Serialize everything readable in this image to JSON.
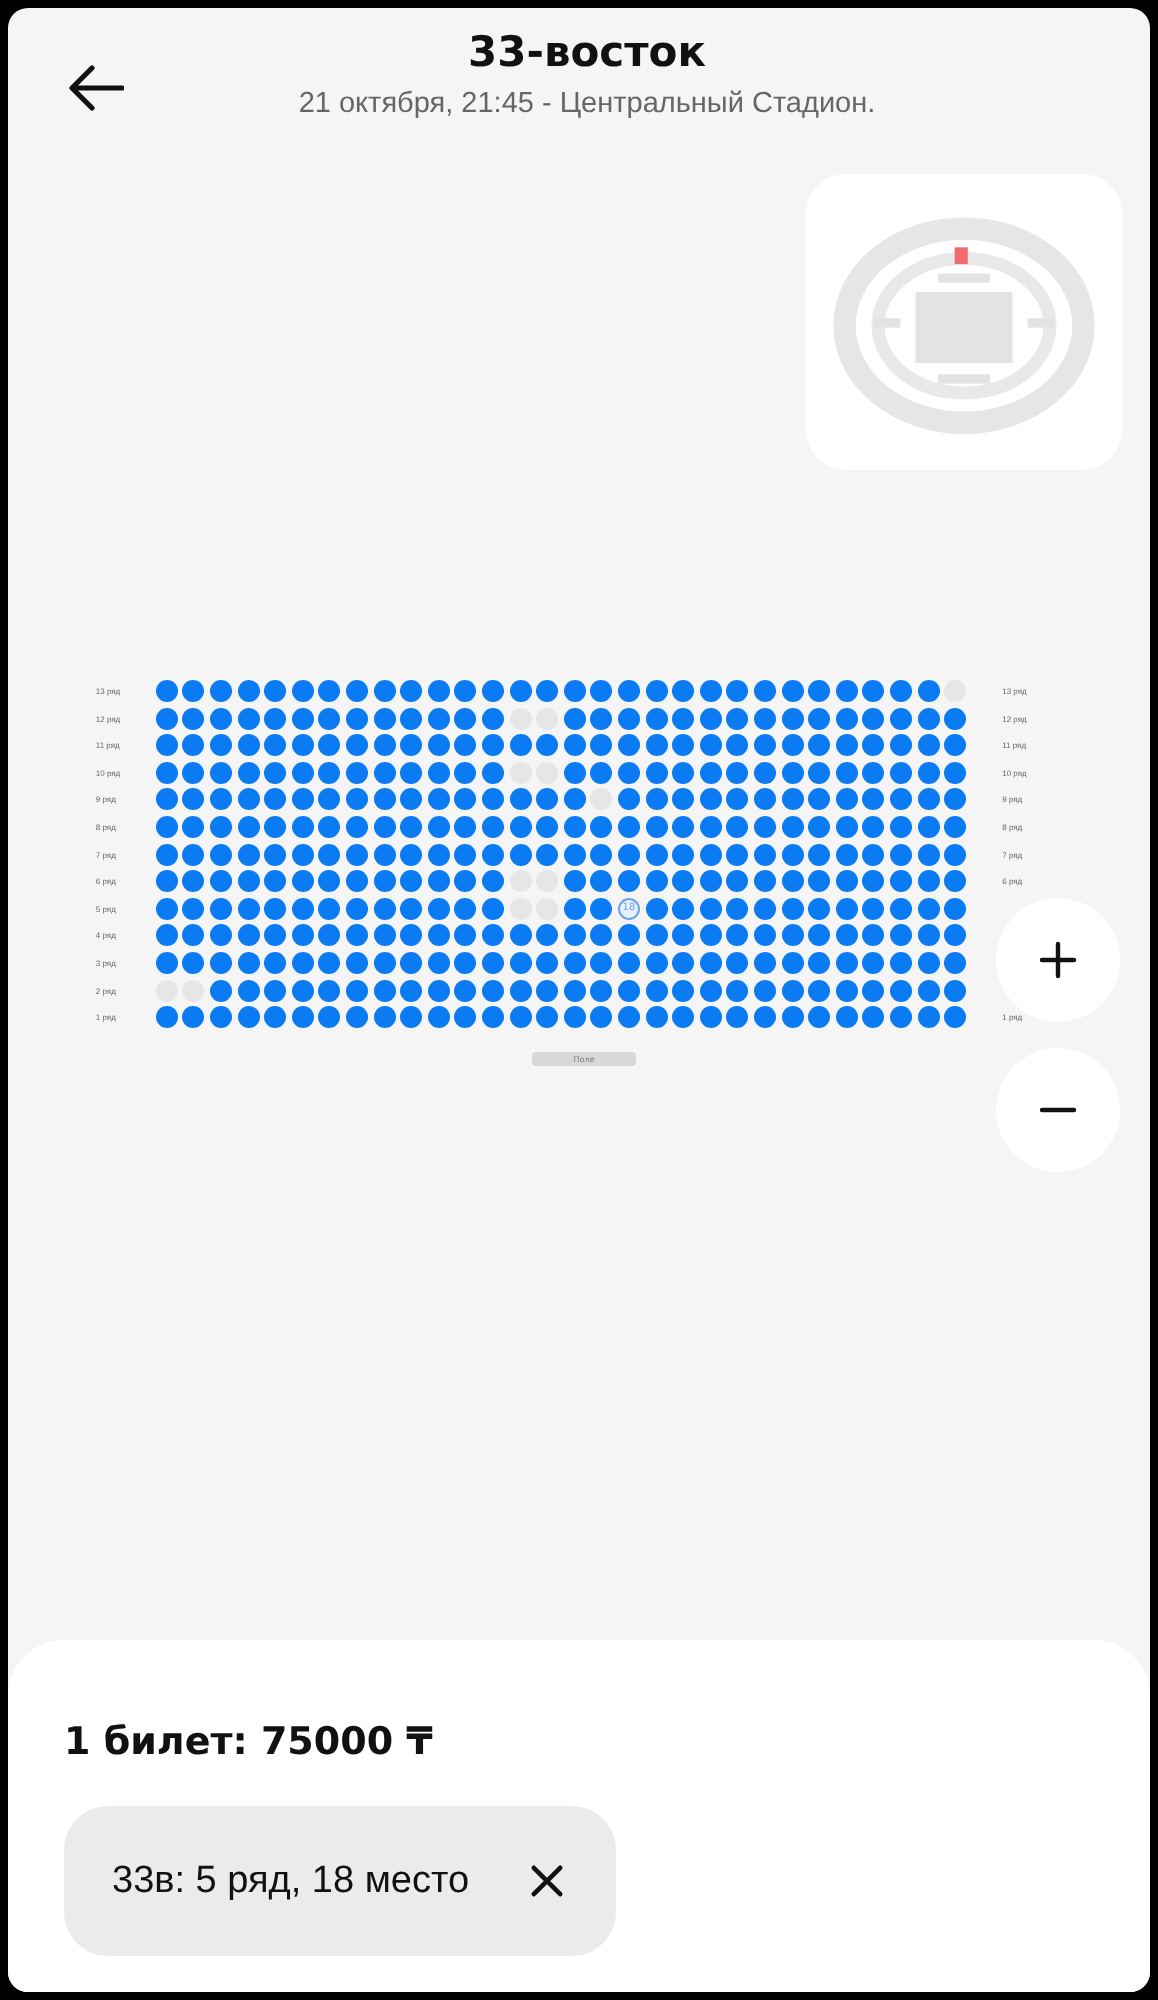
{
  "header": {
    "title": "33-восток",
    "subtitle": "21 октября, 21:45 - Центральный Стадион."
  },
  "seat_map": {
    "rows": [
      {
        "label_left": "13 ряд",
        "label_right": "13 ряд",
        "seats": [
          {
            "taken": false,
            "selected": false
          },
          {
            "taken": false,
            "selected": false
          },
          {
            "taken": false,
            "selected": false
          },
          {
            "taken": false,
            "selected": false
          },
          {
            "taken": false,
            "selected": false
          },
          {
            "taken": false,
            "selected": false
          },
          {
            "taken": false,
            "selected": false
          },
          {
            "taken": false,
            "selected": false
          },
          {
            "taken": false,
            "selected": false
          },
          {
            "taken": false,
            "selected": false
          },
          {
            "taken": false,
            "selected": false
          },
          {
            "taken": false,
            "selected": false
          },
          {
            "taken": false,
            "selected": false
          },
          {
            "taken": false,
            "selected": false
          },
          {
            "taken": false,
            "selected": false
          },
          {
            "taken": false,
            "selected": false
          },
          {
            "taken": false,
            "selected": false
          },
          {
            "taken": false,
            "selected": false
          },
          {
            "taken": false,
            "selected": false
          },
          {
            "taken": false,
            "selected": false
          },
          {
            "taken": false,
            "selected": false
          },
          {
            "taken": false,
            "selected": false
          },
          {
            "taken": false,
            "selected": false
          },
          {
            "taken": false,
            "selected": false
          },
          {
            "taken": false,
            "selected": false
          },
          {
            "taken": false,
            "selected": false
          },
          {
            "taken": false,
            "selected": false
          },
          {
            "taken": false,
            "selected": false
          },
          {
            "taken": false,
            "selected": false
          },
          {
            "taken": true,
            "selected": false
          }
        ]
      },
      {
        "label_left": "12 ряд",
        "label_right": "12 ряд",
        "seats": [
          {
            "taken": false,
            "selected": false
          },
          {
            "taken": false,
            "selected": false
          },
          {
            "taken": false,
            "selected": false
          },
          {
            "taken": false,
            "selected": false
          },
          {
            "taken": false,
            "selected": false
          },
          {
            "taken": false,
            "selected": false
          },
          {
            "taken": false,
            "selected": false
          },
          {
            "taken": false,
            "selected": false
          },
          {
            "taken": false,
            "selected": false
          },
          {
            "taken": false,
            "selected": false
          },
          {
            "taken": false,
            "selected": false
          },
          {
            "taken": false,
            "selected": false
          },
          {
            "taken": false,
            "selected": false
          },
          {
            "taken": true,
            "selected": false
          },
          {
            "taken": true,
            "selected": false
          },
          {
            "taken": false,
            "selected": false
          },
          {
            "taken": false,
            "selected": false
          },
          {
            "taken": false,
            "selected": false
          },
          {
            "taken": false,
            "selected": false
          },
          {
            "taken": false,
            "selected": false
          },
          {
            "taken": false,
            "selected": false
          },
          {
            "taken": false,
            "selected": false
          },
          {
            "taken": false,
            "selected": false
          },
          {
            "taken": false,
            "selected": false
          },
          {
            "taken": false,
            "selected": false
          },
          {
            "taken": false,
            "selected": false
          },
          {
            "taken": false,
            "selected": false
          },
          {
            "taken": false,
            "selected": false
          },
          {
            "taken": false,
            "selected": false
          },
          {
            "taken": false,
            "selected": false
          }
        ]
      },
      {
        "label_left": "11 ряд",
        "label_right": "11 ряд",
        "seats": [
          {
            "taken": false,
            "selected": false
          },
          {
            "taken": false,
            "selected": false
          },
          {
            "taken": false,
            "selected": false
          },
          {
            "taken": false,
            "selected": false
          },
          {
            "taken": false,
            "selected": false
          },
          {
            "taken": false,
            "selected": false
          },
          {
            "taken": false,
            "selected": false
          },
          {
            "taken": false,
            "selected": false
          },
          {
            "taken": false,
            "selected": false
          },
          {
            "taken": false,
            "selected": false
          },
          {
            "taken": false,
            "selected": false
          },
          {
            "taken": false,
            "selected": false
          },
          {
            "taken": false,
            "selected": false
          },
          {
            "taken": false,
            "selected": false
          },
          {
            "taken": false,
            "selected": false
          },
          {
            "taken": false,
            "selected": false
          },
          {
            "taken": false,
            "selected": false
          },
          {
            "taken": false,
            "selected": false
          },
          {
            "taken": false,
            "selected": false
          },
          {
            "taken": false,
            "selected": false
          },
          {
            "taken": false,
            "selected": false
          },
          {
            "taken": false,
            "selected": false
          },
          {
            "taken": false,
            "selected": false
          },
          {
            "taken": false,
            "selected": false
          },
          {
            "taken": false,
            "selected": false
          },
          {
            "taken": false,
            "selected": false
          },
          {
            "taken": false,
            "selected": false
          },
          {
            "taken": false,
            "selected": false
          },
          {
            "taken": false,
            "selected": false
          },
          {
            "taken": false,
            "selected": false
          }
        ]
      },
      {
        "label_left": "10 ряд",
        "label_right": "10 ряд",
        "seats": [
          {
            "taken": false,
            "selected": false
          },
          {
            "taken": false,
            "selected": false
          },
          {
            "taken": false,
            "selected": false
          },
          {
            "taken": false,
            "selected": false
          },
          {
            "taken": false,
            "selected": false
          },
          {
            "taken": false,
            "selected": false
          },
          {
            "taken": false,
            "selected": false
          },
          {
            "taken": false,
            "selected": false
          },
          {
            "taken": false,
            "selected": false
          },
          {
            "taken": false,
            "selected": false
          },
          {
            "taken": false,
            "selected": false
          },
          {
            "taken": false,
            "selected": false
          },
          {
            "taken": false,
            "selected": false
          },
          {
            "taken": true,
            "selected": false
          },
          {
            "taken": true,
            "selected": false
          },
          {
            "taken": false,
            "selected": false
          },
          {
            "taken": false,
            "selected": false
          },
          {
            "taken": false,
            "selected": false
          },
          {
            "taken": false,
            "selected": false
          },
          {
            "taken": false,
            "selected": false
          },
          {
            "taken": false,
            "selected": false
          },
          {
            "taken": false,
            "selected": false
          },
          {
            "taken": false,
            "selected": false
          },
          {
            "taken": false,
            "selected": false
          },
          {
            "taken": false,
            "selected": false
          },
          {
            "taken": false,
            "selected": false
          },
          {
            "taken": false,
            "selected": false
          },
          {
            "taken": false,
            "selected": false
          },
          {
            "taken": false,
            "selected": false
          },
          {
            "taken": false,
            "selected": false
          }
        ]
      },
      {
        "label_left": "9 ряд",
        "label_right": "9 ряд",
        "seats": [
          {
            "taken": false,
            "selected": false
          },
          {
            "taken": false,
            "selected": false
          },
          {
            "taken": false,
            "selected": false
          },
          {
            "taken": false,
            "selected": false
          },
          {
            "taken": false,
            "selected": false
          },
          {
            "taken": false,
            "selected": false
          },
          {
            "taken": false,
            "selected": false
          },
          {
            "taken": false,
            "selected": false
          },
          {
            "taken": false,
            "selected": false
          },
          {
            "taken": false,
            "selected": false
          },
          {
            "taken": false,
            "selected": false
          },
          {
            "taken": false,
            "selected": false
          },
          {
            "taken": false,
            "selected": false
          },
          {
            "taken": false,
            "selected": false
          },
          {
            "taken": false,
            "selected": false
          },
          {
            "taken": false,
            "selected": false
          },
          {
            "taken": true,
            "selected": false
          },
          {
            "taken": false,
            "selected": false
          },
          {
            "taken": false,
            "selected": false
          },
          {
            "taken": false,
            "selected": false
          },
          {
            "taken": false,
            "selected": false
          },
          {
            "taken": false,
            "selected": false
          },
          {
            "taken": false,
            "selected": false
          },
          {
            "taken": false,
            "selected": false
          },
          {
            "taken": false,
            "selected": false
          },
          {
            "taken": false,
            "selected": false
          },
          {
            "taken": false,
            "selected": false
          },
          {
            "taken": false,
            "selected": false
          },
          {
            "taken": false,
            "selected": false
          },
          {
            "taken": false,
            "selected": false
          }
        ]
      },
      {
        "label_left": "8 ряд",
        "label_right": "8 ряд",
        "seats": [
          {
            "taken": false,
            "selected": false
          },
          {
            "taken": false,
            "selected": false
          },
          {
            "taken": false,
            "selected": false
          },
          {
            "taken": false,
            "selected": false
          },
          {
            "taken": false,
            "selected": false
          },
          {
            "taken": false,
            "selected": false
          },
          {
            "taken": false,
            "selected": false
          },
          {
            "taken": false,
            "selected": false
          },
          {
            "taken": false,
            "selected": false
          },
          {
            "taken": false,
            "selected": false
          },
          {
            "taken": false,
            "selected": false
          },
          {
            "taken": false,
            "selected": false
          },
          {
            "taken": false,
            "selected": false
          },
          {
            "taken": false,
            "selected": false
          },
          {
            "taken": false,
            "selected": false
          },
          {
            "taken": false,
            "selected": false
          },
          {
            "taken": false,
            "selected": false
          },
          {
            "taken": false,
            "selected": false
          },
          {
            "taken": false,
            "selected": false
          },
          {
            "taken": false,
            "selected": false
          },
          {
            "taken": false,
            "selected": false
          },
          {
            "taken": false,
            "selected": false
          },
          {
            "taken": false,
            "selected": false
          },
          {
            "taken": false,
            "selected": false
          },
          {
            "taken": false,
            "selected": false
          },
          {
            "taken": false,
            "selected": false
          },
          {
            "taken": false,
            "selected": false
          },
          {
            "taken": false,
            "selected": false
          },
          {
            "taken": false,
            "selected": false
          },
          {
            "taken": false,
            "selected": false
          }
        ]
      },
      {
        "label_left": "7 ряд",
        "label_right": "7 ряд",
        "seats": [
          {
            "taken": false,
            "selected": false
          },
          {
            "taken": false,
            "selected": false
          },
          {
            "taken": false,
            "selected": false
          },
          {
            "taken": false,
            "selected": false
          },
          {
            "taken": false,
            "selected": false
          },
          {
            "taken": false,
            "selected": false
          },
          {
            "taken": false,
            "selected": false
          },
          {
            "taken": false,
            "selected": false
          },
          {
            "taken": false,
            "selected": false
          },
          {
            "taken": false,
            "selected": false
          },
          {
            "taken": false,
            "selected": false
          },
          {
            "taken": false,
            "selected": false
          },
          {
            "taken": false,
            "selected": false
          },
          {
            "taken": false,
            "selected": false
          },
          {
            "taken": false,
            "selected": false
          },
          {
            "taken": false,
            "selected": false
          },
          {
            "taken": false,
            "selected": false
          },
          {
            "taken": false,
            "selected": false
          },
          {
            "taken": false,
            "selected": false
          },
          {
            "taken": false,
            "selected": false
          },
          {
            "taken": false,
            "selected": false
          },
          {
            "taken": false,
            "selected": false
          },
          {
            "taken": false,
            "selected": false
          },
          {
            "taken": false,
            "selected": false
          },
          {
            "taken": false,
            "selected": false
          },
          {
            "taken": false,
            "selected": false
          },
          {
            "taken": false,
            "selected": false
          },
          {
            "taken": false,
            "selected": false
          },
          {
            "taken": false,
            "selected": false
          },
          {
            "taken": false,
            "selected": false
          }
        ]
      },
      {
        "label_left": "6 ряд",
        "label_right": "6 ряд",
        "seats": [
          {
            "taken": false,
            "selected": false
          },
          {
            "taken": false,
            "selected": false
          },
          {
            "taken": false,
            "selected": false
          },
          {
            "taken": false,
            "selected": false
          },
          {
            "taken": false,
            "selected": false
          },
          {
            "taken": false,
            "selected": false
          },
          {
            "taken": false,
            "selected": false
          },
          {
            "taken": false,
            "selected": false
          },
          {
            "taken": false,
            "selected": false
          },
          {
            "taken": false,
            "selected": false
          },
          {
            "taken": false,
            "selected": false
          },
          {
            "taken": false,
            "selected": false
          },
          {
            "taken": false,
            "selected": false
          },
          {
            "taken": true,
            "selected": false
          },
          {
            "taken": true,
            "selected": false
          },
          {
            "taken": false,
            "selected": false
          },
          {
            "taken": false,
            "selected": false
          },
          {
            "taken": false,
            "selected": false
          },
          {
            "taken": false,
            "selected": false
          },
          {
            "taken": false,
            "selected": false
          },
          {
            "taken": false,
            "selected": false
          },
          {
            "taken": false,
            "selected": false
          },
          {
            "taken": false,
            "selected": false
          },
          {
            "taken": false,
            "selected": false
          },
          {
            "taken": false,
            "selected": false
          },
          {
            "taken": false,
            "selected": false
          },
          {
            "taken": false,
            "selected": false
          },
          {
            "taken": false,
            "selected": false
          },
          {
            "taken": false,
            "selected": false
          },
          {
            "taken": false,
            "selected": false
          }
        ]
      },
      {
        "label_left": "5 ряд",
        "seats": [
          {
            "taken": false,
            "selected": false
          },
          {
            "taken": false,
            "selected": false
          },
          {
            "taken": false,
            "selected": false
          },
          {
            "taken": false,
            "selected": false
          },
          {
            "taken": false,
            "selected": false
          },
          {
            "taken": false,
            "selected": false
          },
          {
            "taken": false,
            "selected": false
          },
          {
            "taken": false,
            "selected": false
          },
          {
            "taken": false,
            "selected": false
          },
          {
            "taken": false,
            "selected": false
          },
          {
            "taken": false,
            "selected": false
          },
          {
            "taken": false,
            "selected": false
          },
          {
            "taken": false,
            "selected": false
          },
          {
            "taken": true,
            "selected": false
          },
          {
            "taken": true,
            "selected": false
          },
          {
            "taken": false,
            "selected": false
          },
          {
            "taken": false,
            "selected": false
          },
          {
            "taken": false,
            "selected": true,
            "label": "18"
          },
          {
            "taken": false,
            "selected": false
          },
          {
            "taken": false,
            "selected": false
          },
          {
            "taken": false,
            "selected": false
          },
          {
            "taken": false,
            "selected": false
          },
          {
            "taken": false,
            "selected": false
          },
          {
            "taken": false,
            "selected": false
          },
          {
            "taken": false,
            "selected": false
          },
          {
            "taken": false,
            "selected": false
          },
          {
            "taken": false,
            "selected": false
          },
          {
            "taken": false,
            "selected": false
          },
          {
            "taken": false,
            "selected": false
          },
          {
            "taken": false,
            "selected": false
          }
        ]
      },
      {
        "label_left": "4 ряд",
        "seats": [
          {
            "taken": false,
            "selected": false
          },
          {
            "taken": false,
            "selected": false
          },
          {
            "taken": false,
            "selected": false
          },
          {
            "taken": false,
            "selected": false
          },
          {
            "taken": false,
            "selected": false
          },
          {
            "taken": false,
            "selected": false
          },
          {
            "taken": false,
            "selected": false
          },
          {
            "taken": false,
            "selected": false
          },
          {
            "taken": false,
            "selected": false
          },
          {
            "taken": false,
            "selected": false
          },
          {
            "taken": false,
            "selected": false
          },
          {
            "taken": false,
            "selected": false
          },
          {
            "taken": false,
            "selected": false
          },
          {
            "taken": false,
            "selected": false
          },
          {
            "taken": false,
            "selected": false
          },
          {
            "taken": false,
            "selected": false
          },
          {
            "taken": false,
            "selected": false
          },
          {
            "taken": false,
            "selected": false
          },
          {
            "taken": false,
            "selected": false
          },
          {
            "taken": false,
            "selected": false
          },
          {
            "taken": false,
            "selected": false
          },
          {
            "taken": false,
            "selected": false
          },
          {
            "taken": false,
            "selected": false
          },
          {
            "taken": false,
            "selected": false
          },
          {
            "taken": false,
            "selected": false
          },
          {
            "taken": false,
            "selected": false
          },
          {
            "taken": false,
            "selected": false
          },
          {
            "taken": false,
            "selected": false
          },
          {
            "taken": false,
            "selected": false
          },
          {
            "taken": false,
            "selected": false
          }
        ]
      },
      {
        "label_left": "3 ряд",
        "seats": [
          {
            "taken": false,
            "selected": false
          },
          {
            "taken": false,
            "selected": false
          },
          {
            "taken": false,
            "selected": false
          },
          {
            "taken": false,
            "selected": false
          },
          {
            "taken": false,
            "selected": false
          },
          {
            "taken": false,
            "selected": false
          },
          {
            "taken": false,
            "selected": false
          },
          {
            "taken": false,
            "selected": false
          },
          {
            "taken": false,
            "selected": false
          },
          {
            "taken": false,
            "selected": false
          },
          {
            "taken": false,
            "selected": false
          },
          {
            "taken": false,
            "selected": false
          },
          {
            "taken": false,
            "selected": false
          },
          {
            "taken": false,
            "selected": false
          },
          {
            "taken": false,
            "selected": false
          },
          {
            "taken": false,
            "selected": false
          },
          {
            "taken": false,
            "selected": false
          },
          {
            "taken": false,
            "selected": false
          },
          {
            "taken": false,
            "selected": false
          },
          {
            "taken": false,
            "selected": false
          },
          {
            "taken": false,
            "selected": false
          },
          {
            "taken": false,
            "selected": false
          },
          {
            "taken": false,
            "selected": false
          },
          {
            "taken": false,
            "selected": false
          },
          {
            "taken": false,
            "selected": false
          },
          {
            "taken": false,
            "selected": false
          },
          {
            "taken": false,
            "selected": false
          },
          {
            "taken": false,
            "selected": false
          },
          {
            "taken": false,
            "selected": false
          },
          {
            "taken": false,
            "selected": false
          }
        ]
      },
      {
        "label_left": "2 ряд",
        "seats": [
          {
            "taken": true,
            "selected": false
          },
          {
            "taken": true,
            "selected": false
          },
          {
            "taken": false,
            "selected": false
          },
          {
            "taken": false,
            "selected": false
          },
          {
            "taken": false,
            "selected": false
          },
          {
            "taken": false,
            "selected": false
          },
          {
            "taken": false,
            "selected": false
          },
          {
            "taken": false,
            "selected": false
          },
          {
            "taken": false,
            "selected": false
          },
          {
            "taken": false,
            "selected": false
          },
          {
            "taken": false,
            "selected": false
          },
          {
            "taken": false,
            "selected": false
          },
          {
            "taken": false,
            "selected": false
          },
          {
            "taken": false,
            "selected": false
          },
          {
            "taken": false,
            "selected": false
          },
          {
            "taken": false,
            "selected": false
          },
          {
            "taken": false,
            "selected": false
          },
          {
            "taken": false,
            "selected": false
          },
          {
            "taken": false,
            "selected": false
          },
          {
            "taken": false,
            "selected": false
          },
          {
            "taken": false,
            "selected": false
          },
          {
            "taken": false,
            "selected": false
          },
          {
            "taken": false,
            "selected": false
          },
          {
            "taken": false,
            "selected": false
          },
          {
            "taken": false,
            "selected": false
          },
          {
            "taken": false,
            "selected": false
          },
          {
            "taken": false,
            "selected": false
          },
          {
            "taken": false,
            "selected": false
          },
          {
            "taken": false,
            "selected": false
          },
          {
            "taken": false,
            "selected": false
          }
        ]
      },
      {
        "label_left": "1 ряд",
        "label_right": "1 ряд",
        "seats": [
          {
            "taken": false,
            "selected": false
          },
          {
            "taken": false,
            "selected": false
          },
          {
            "taken": false,
            "selected": false
          },
          {
            "taken": false,
            "selected": false
          },
          {
            "taken": false,
            "selected": false
          },
          {
            "taken": false,
            "selected": false
          },
          {
            "taken": false,
            "selected": false
          },
          {
            "taken": false,
            "selected": false
          },
          {
            "taken": false,
            "selected": false
          },
          {
            "taken": false,
            "selected": false
          },
          {
            "taken": false,
            "selected": false
          },
          {
            "taken": false,
            "selected": false
          },
          {
            "taken": false,
            "selected": false
          },
          {
            "taken": false,
            "selected": false
          },
          {
            "taken": false,
            "selected": false
          },
          {
            "taken": false,
            "selected": false
          },
          {
            "taken": false,
            "selected": false
          },
          {
            "taken": false,
            "selected": false
          },
          {
            "taken": false,
            "selected": false
          },
          {
            "taken": false,
            "selected": false
          },
          {
            "taken": false,
            "selected": false
          },
          {
            "taken": false,
            "selected": false
          },
          {
            "taken": false,
            "selected": false
          },
          {
            "taken": false,
            "selected": false
          },
          {
            "taken": false,
            "selected": false
          },
          {
            "taken": false,
            "selected": false
          },
          {
            "taken": false,
            "selected": false
          },
          {
            "taken": false,
            "selected": false
          },
          {
            "taken": false,
            "selected": false
          },
          {
            "taken": false,
            "selected": false
          }
        ]
      }
    ],
    "field_label": "Поле"
  },
  "cart": {
    "summary": "1 билет: 75000 ₸",
    "tickets": [
      {
        "label": "33в: 5 ряд, 18 место"
      }
    ]
  }
}
